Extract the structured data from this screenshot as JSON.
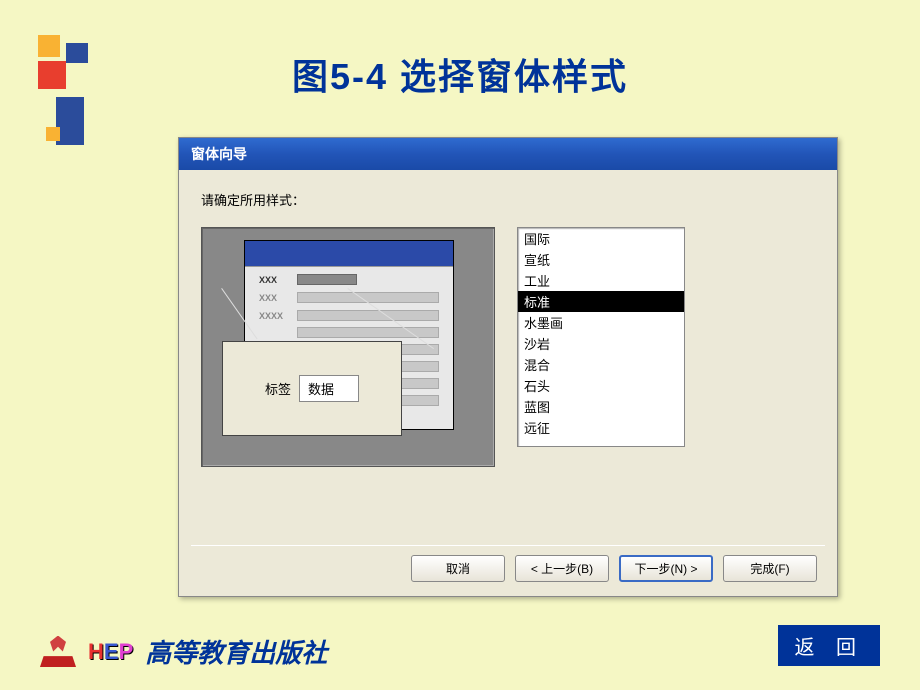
{
  "page": {
    "title": "图5-4  选择窗体样式",
    "publisher": "高等教育出版社",
    "logo_text": {
      "h": "H",
      "e": "E",
      "p": "P"
    },
    "return_btn": "返 回"
  },
  "dialog": {
    "title": "窗体向导",
    "prompt": "请确定所用样式：",
    "preview": {
      "row1_label": "XXX",
      "row2_label": "XXX",
      "row3_label": "XXXX",
      "zoom_label": "标签",
      "zoom_value": "数据"
    },
    "styles": {
      "items": [
        {
          "label": "国际"
        },
        {
          "label": "宣纸"
        },
        {
          "label": "工业"
        },
        {
          "label": "标准"
        },
        {
          "label": "水墨画"
        },
        {
          "label": "沙岩"
        },
        {
          "label": "混合"
        },
        {
          "label": "石头"
        },
        {
          "label": "蓝图"
        },
        {
          "label": "远征"
        }
      ],
      "selected_index": 3
    },
    "buttons": {
      "cancel": "取消",
      "back": "< 上一步(B)",
      "next": "下一步(N) >",
      "finish": "完成(F)"
    }
  }
}
